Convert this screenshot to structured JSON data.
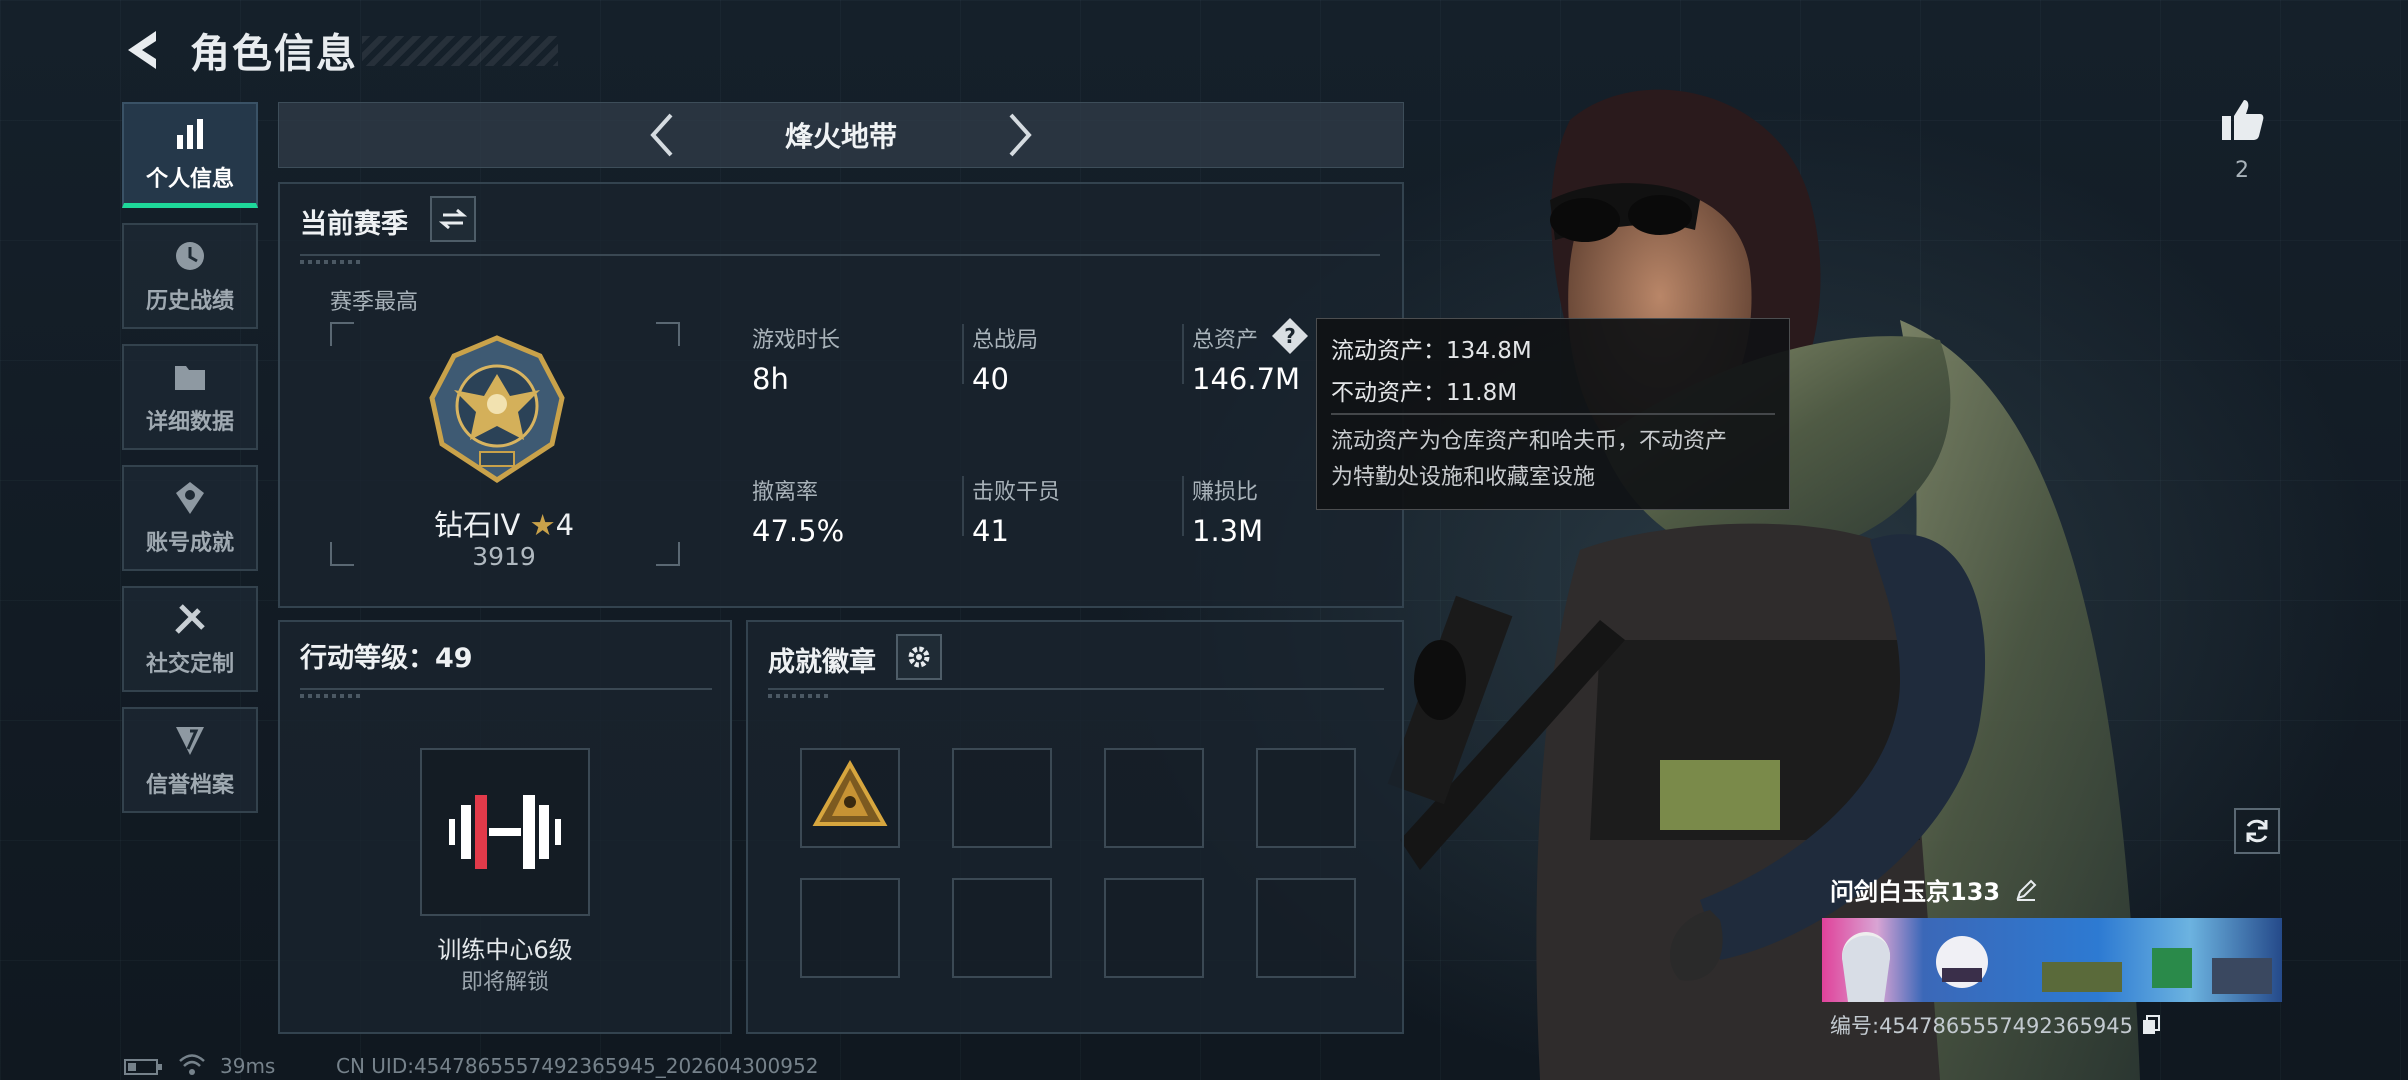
{
  "header": {
    "title": "角色信息"
  },
  "nav": [
    {
      "label": "个人信息",
      "icon": "bar-chart-icon",
      "active": true
    },
    {
      "label": "历史战绩",
      "icon": "history-icon"
    },
    {
      "label": "详细数据",
      "icon": "folder-icon"
    },
    {
      "label": "账号成就",
      "icon": "achievement-icon"
    },
    {
      "label": "社交定制",
      "icon": "tools-icon"
    },
    {
      "label": "信誉档案",
      "icon": "credit-icon"
    }
  ],
  "mode_bar": {
    "mode": "烽火地带"
  },
  "season": {
    "title": "当前赛季",
    "best_label": "赛季最高",
    "rank_name": "钻石IV",
    "rank_stars": "4",
    "rank_score": "3919",
    "stats": {
      "play_time": {
        "label": "游戏时长",
        "value": "8h"
      },
      "total_matches": {
        "label": "总战局",
        "value": "40"
      },
      "total_assets": {
        "label": "总资产",
        "value": "146.7M"
      },
      "extract_rate": {
        "label": "撤离率",
        "value": "47.5%"
      },
      "kills": {
        "label": "击败干员",
        "value": "41"
      },
      "profit_ratio": {
        "label": "赚损比",
        "value": "1.3M"
      }
    }
  },
  "tooltip": {
    "line1": "流动资产：134.8M",
    "line2": "不动资产：11.8M",
    "desc1": "流动资产为仓库资产和哈夫币，不动资产",
    "desc2": "为特勤处设施和收藏室设施"
  },
  "action_level": {
    "title": "行动等级：49",
    "item_name": "训练中心6级",
    "item_status": "即将解锁"
  },
  "badges": {
    "title": "成就徽章",
    "slots": 8
  },
  "likes": {
    "count": "2"
  },
  "player": {
    "name": "问剑白玉京133",
    "id_line": "编号:4547865557492365945"
  },
  "status_bar": {
    "ping": "39ms",
    "uid": "CN UID:4547865557492365945_202604300952"
  },
  "colors": {
    "accent": "#1ed89a",
    "gold": "#c9a24a"
  }
}
